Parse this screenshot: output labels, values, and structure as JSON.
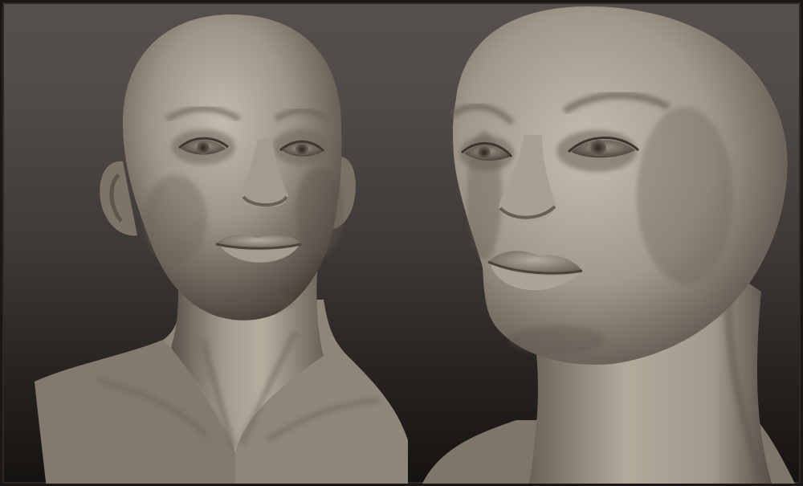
{
  "image": {
    "subject": "",
    "views": [
      "front-view",
      "three-quarter-view"
    ]
  },
  "colors": {
    "background_top": "#55504c",
    "background_bottom": "#151311",
    "skin_highlight": "#c2b9ac",
    "skin_mid": "#8f8579",
    "skin_shadow": "#433b35",
    "frame": "#1a1816"
  }
}
